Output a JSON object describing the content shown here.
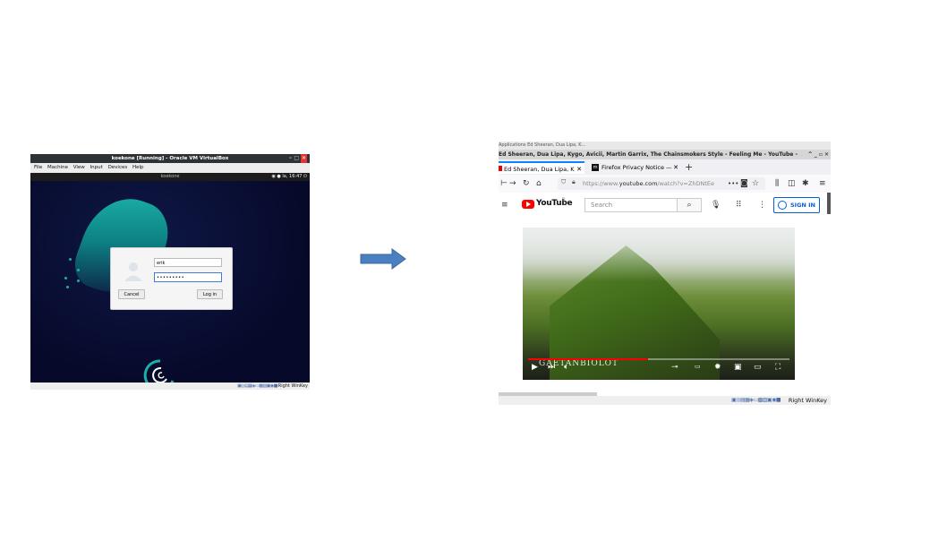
{
  "left": {
    "window_title": "koekone [Running] - Oracle VM VirtualBox",
    "menu": [
      "File",
      "Machine",
      "View",
      "Input",
      "Devices",
      "Help"
    ],
    "guest_hostname": "koekone",
    "guest_clock": "la, 16:47",
    "login": {
      "username": "erik",
      "password_mask": "•••••••••",
      "cancel_label": "Cancel",
      "login_label": "Log in"
    },
    "os_logo_text": "debian",
    "host_key": "Right WinKey"
  },
  "right": {
    "host_topbar": "Applications   Ed Sheeran, Dua Lipa, K...",
    "window_title": "Ed Sheeran, Dua Lipa, Kygo, Avicii, Martin Garrix, The Chainsmokers Style - Feeling Me - YouTube -",
    "tabs": [
      {
        "label": "Ed Sheeran, Dua Lipa, K"
      },
      {
        "label": "Firefox Privacy Notice —"
      }
    ],
    "url_prefix": "https://www.",
    "url_domain": "youtube.com",
    "url_rest": "/watch?v=ZhDNtEe",
    "youtube": {
      "logo_text": "YouTube",
      "logo_sup": "FI",
      "search_placeholder": "Search",
      "signin_label": "SIGN IN"
    },
    "video": {
      "watermark": "GAETANBIOLOT",
      "progress": 0.46
    },
    "host_key": "Right WinKey"
  },
  "icons": {
    "back": "back-icon",
    "forward": "forward-icon",
    "reload": "reload-icon",
    "home": "home-icon",
    "menu": "hamburger-menu-icon",
    "mic": "microphone-icon",
    "apps": "apps-grid-icon",
    "more": "more-vert-icon",
    "search": "search-icon",
    "user": "user-circle-icon"
  },
  "colors": {
    "debian_teal": "#1ab0a8",
    "youtube_red": "#ff0000",
    "firefox_blue": "#0a84ff",
    "signin_blue": "#065fd4",
    "arrow_fill": "#4a7fc1"
  }
}
